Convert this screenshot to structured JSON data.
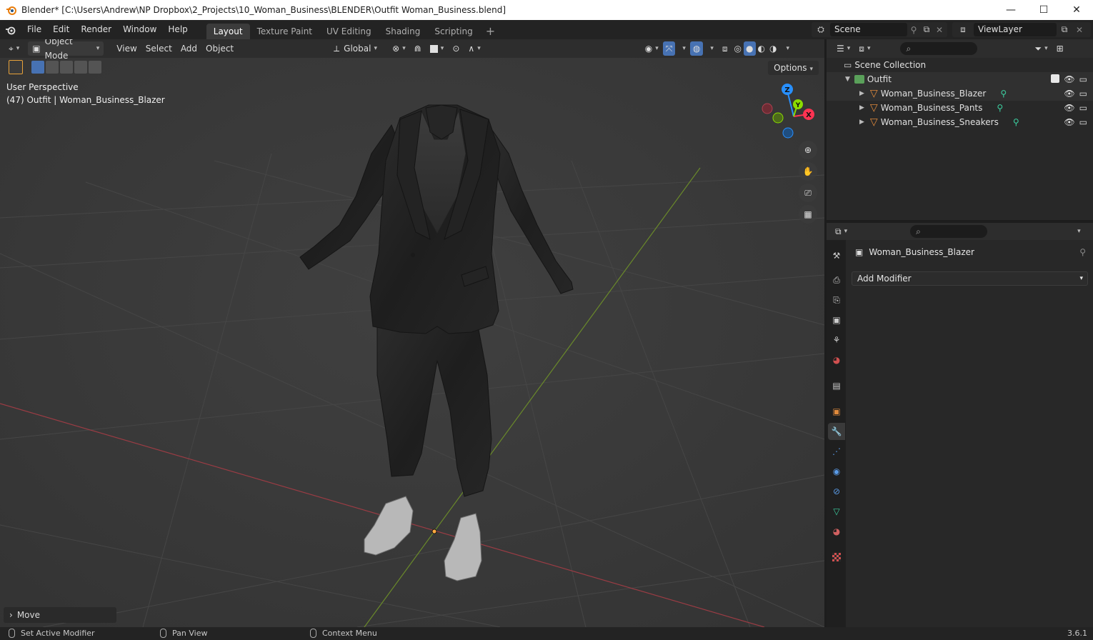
{
  "window": {
    "title": "Blender* [C:\\Users\\Andrew\\NP Dropbox\\2_Projects\\10_Woman_Business\\BLENDER\\Outfit Woman_Business.blend]",
    "minimize_glyph": "—",
    "maximize_glyph": "☐",
    "close_glyph": "✕"
  },
  "menu": {
    "items": [
      "File",
      "Edit",
      "Render",
      "Window",
      "Help"
    ],
    "workspaces": [
      "Layout",
      "Texture Paint",
      "UV Editing",
      "Shading",
      "Scripting"
    ],
    "active_workspace": "Layout",
    "add_tab": "+"
  },
  "scene": {
    "name": "Scene",
    "view_layer": "ViewLayer"
  },
  "viewport": {
    "mode": "Object Mode",
    "menus": [
      "View",
      "Select",
      "Add",
      "Object"
    ],
    "orientation": "Global",
    "options_label": "Options",
    "perspective_label": "User Perspective",
    "object_info": "(47) Outfit | Woman_Business_Blazer",
    "gizmo": {
      "z": "Z",
      "y": "Y",
      "x": "X"
    },
    "last_op": "Move",
    "accent_x": "#ff3352",
    "accent_y": "#8bdc00",
    "accent_z": "#2890ff"
  },
  "outliner": {
    "root": "Scene Collection",
    "collection": "Outfit",
    "objects": [
      "Woman_Business_Blazer",
      "Woman_Business_Pants",
      "Woman_Business_Sneakers"
    ]
  },
  "properties": {
    "object_name": "Woman_Business_Blazer",
    "add_modifier": "Add Modifier",
    "active_tab": "modifier-tab"
  },
  "status": {
    "left": "Set Active Modifier",
    "middle": "Pan View",
    "right": "Context Menu",
    "version": "3.6.1"
  }
}
